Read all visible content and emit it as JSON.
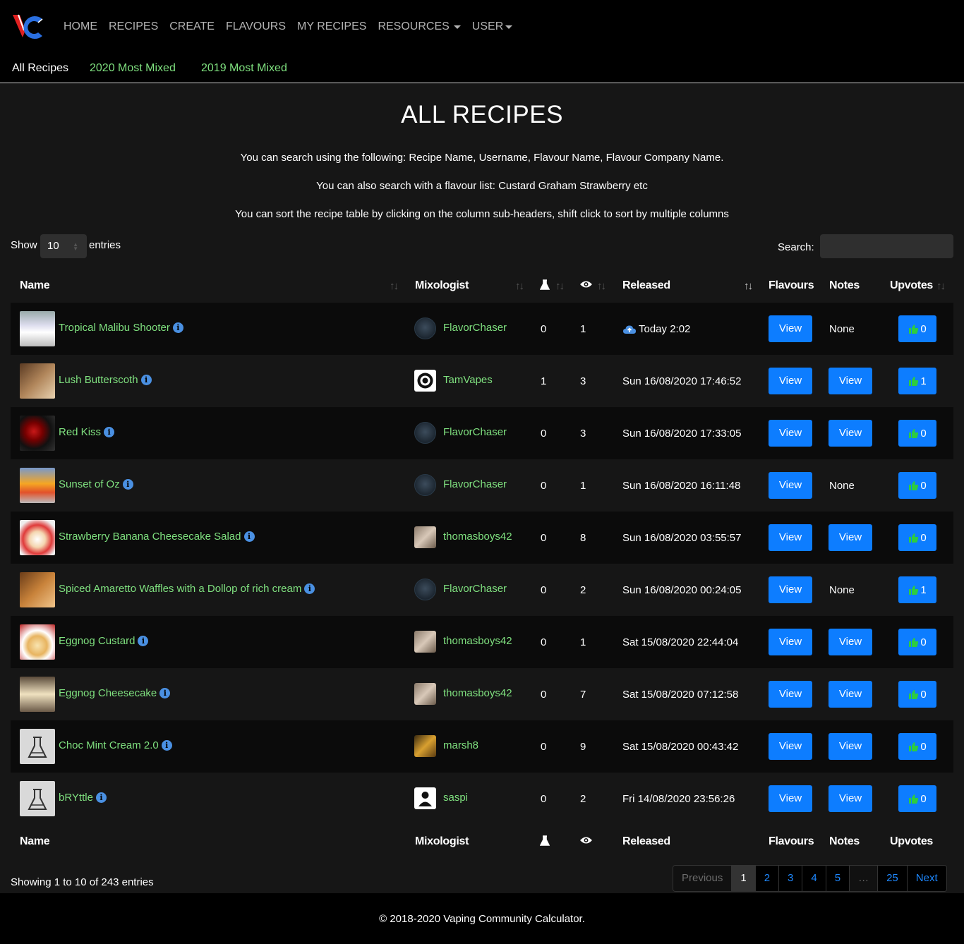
{
  "nav": {
    "items": [
      "HOME",
      "RECIPES",
      "CREATE",
      "FLAVOURS",
      "MY RECIPES",
      "RESOURCES",
      "USER"
    ]
  },
  "subnav": {
    "all": "All Recipes",
    "most2020": "2020 Most Mixed",
    "most2019": "2019 Most Mixed"
  },
  "page": {
    "title": "ALL RECIPES",
    "info1": "You can search using the following: Recipe Name, Username, Flavour Name, Flavour Company Name.",
    "info2": "You can also search with a flavour list: Custard Graham Strawberry etc",
    "info3": "You can sort the recipe table by clicking on the column sub-headers, shift click to sort by multiple columns"
  },
  "controls": {
    "show": "Show",
    "entries_value": "10",
    "entries": "entries",
    "search_label": "Search:"
  },
  "table": {
    "headers": {
      "name": "Name",
      "mixologist": "Mixologist",
      "released": "Released",
      "flavours": "Flavours",
      "notes": "Notes",
      "upvotes": "Upvotes"
    },
    "view_label": "View",
    "none_label": "None",
    "rows": [
      {
        "name": "Tropical Malibu Shooter",
        "mixologist": "FlavorChaser",
        "mixes": "0",
        "views": "1",
        "released": "Today 2:02",
        "has_cloud": true,
        "notes": false,
        "upvotes": "0"
      },
      {
        "name": "Lush Butterscoth",
        "mixologist": "TamVapes",
        "mixes": "1",
        "views": "3",
        "released": "Sun 16/08/2020 17:46:52",
        "has_cloud": false,
        "notes": true,
        "upvotes": "1"
      },
      {
        "name": "Red Kiss",
        "mixologist": "FlavorChaser",
        "mixes": "0",
        "views": "3",
        "released": "Sun 16/08/2020 17:33:05",
        "has_cloud": false,
        "notes": true,
        "upvotes": "0"
      },
      {
        "name": "Sunset of Oz",
        "mixologist": "FlavorChaser",
        "mixes": "0",
        "views": "1",
        "released": "Sun 16/08/2020 16:11:48",
        "has_cloud": false,
        "notes": false,
        "upvotes": "0"
      },
      {
        "name": "Strawberry Banana Cheesecake Salad",
        "mixologist": "thomasboys42",
        "mixes": "0",
        "views": "8",
        "released": "Sun 16/08/2020 03:55:57",
        "has_cloud": false,
        "notes": true,
        "upvotes": "0"
      },
      {
        "name": "Spiced Amaretto Waffles with a Dollop of rich cream",
        "mixologist": "FlavorChaser",
        "mixes": "0",
        "views": "2",
        "released": "Sun 16/08/2020 00:24:05",
        "has_cloud": false,
        "notes": false,
        "upvotes": "1"
      },
      {
        "name": "Eggnog Custard",
        "mixologist": "thomasboys42",
        "mixes": "0",
        "views": "1",
        "released": "Sat 15/08/2020 22:44:04",
        "has_cloud": false,
        "notes": true,
        "upvotes": "0"
      },
      {
        "name": "Eggnog Cheesecake",
        "mixologist": "thomasboys42",
        "mixes": "0",
        "views": "7",
        "released": "Sat 15/08/2020 07:12:58",
        "has_cloud": false,
        "notes": true,
        "upvotes": "0"
      },
      {
        "name": "Choc Mint Cream 2.0",
        "mixologist": "marsh8",
        "mixes": "0",
        "views": "9",
        "released": "Sat 15/08/2020 00:43:42",
        "has_cloud": false,
        "notes": true,
        "upvotes": "0"
      },
      {
        "name": "bRYttle",
        "mixologist": "saspi",
        "mixes": "0",
        "views": "2",
        "released": "Fri 14/08/2020 23:56:26",
        "has_cloud": false,
        "notes": true,
        "upvotes": "0"
      }
    ]
  },
  "pagination": {
    "showing": "Showing 1 to 10 of 243 entries",
    "previous": "Previous",
    "pages": [
      "1",
      "2",
      "3",
      "4",
      "5"
    ],
    "ellipsis": "…",
    "last": "25",
    "next": "Next"
  },
  "footer": {
    "copyright": "© 2018-2020 Vaping Community Calculator."
  },
  "colors": {
    "link_green": "#7fe07f",
    "button_blue": "#0d7dff",
    "upvote_green": "#2ecc40"
  }
}
